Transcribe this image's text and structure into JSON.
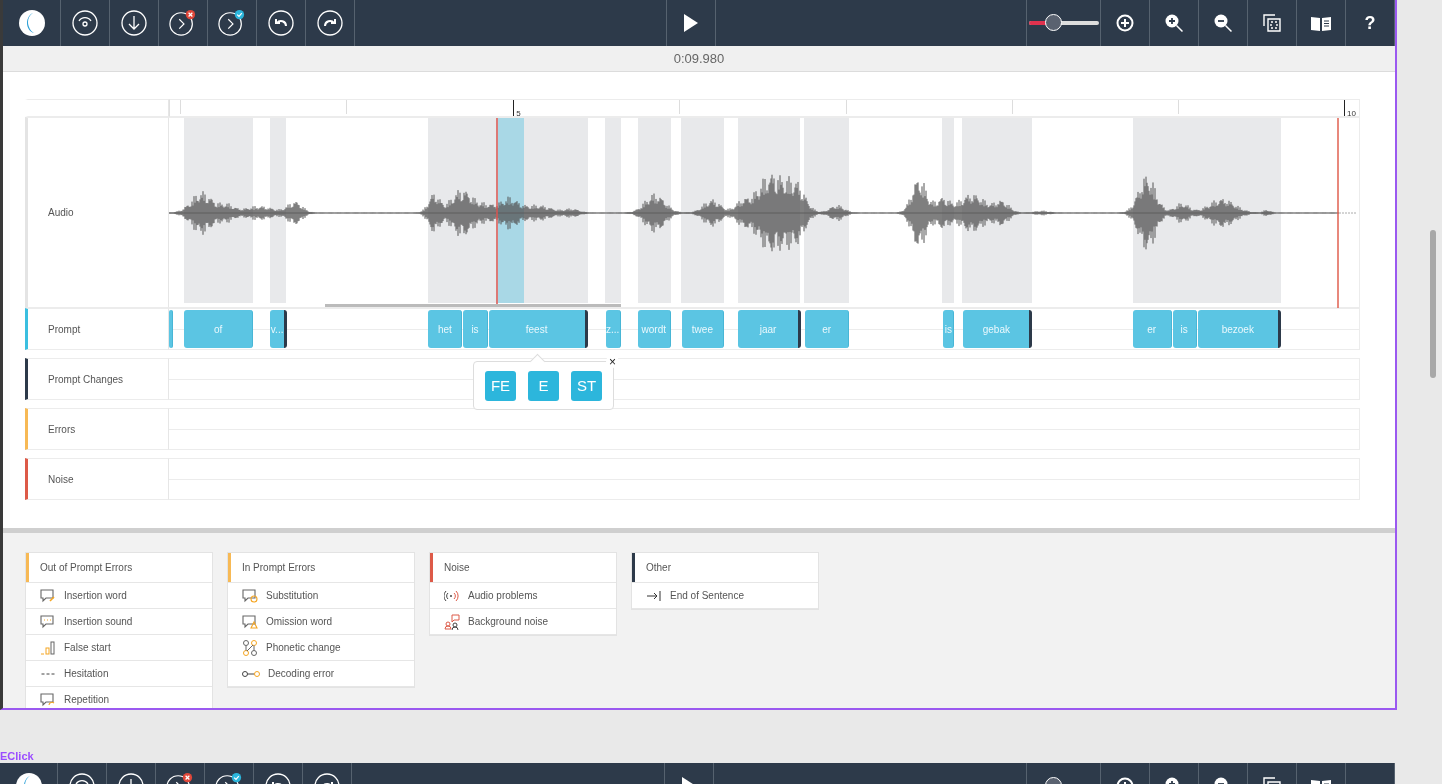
{
  "toolbar": {
    "zoom_slider": {
      "level": 0.35
    },
    "help": "?"
  },
  "time": "0:09.980",
  "timeline": {
    "ruler_labels": [
      "5",
      "10"
    ],
    "tracks": [
      {
        "name": "Audio",
        "kind": "audio",
        "color": "#e4e4e4"
      },
      {
        "name": "Prompt",
        "kind": "prompt",
        "color": "#3bbfe0"
      },
      {
        "name": "Prompt Changes",
        "kind": "lane",
        "color": "#2d3a4a"
      },
      {
        "name": "Errors",
        "kind": "lane",
        "color": "#f7b955"
      },
      {
        "name": "Noise",
        "kind": "lane",
        "color": "#dd5a48"
      }
    ],
    "prompt_words": [
      {
        "end_marker": false
      },
      {
        "text": "of",
        "end_marker": false
      },
      {
        "text": "v...",
        "end_marker": true
      },
      {
        "text": "het",
        "end_marker": false
      },
      {
        "text": "is",
        "end_marker": false
      },
      {
        "text": "feest",
        "end_marker": true
      },
      {
        "text": "z...",
        "end_marker": false
      },
      {
        "text": "wordt",
        "end_marker": false
      },
      {
        "text": "twee",
        "end_marker": false
      },
      {
        "text": "jaar",
        "end_marker": true
      },
      {
        "text": "er",
        "end_marker": false
      },
      {
        "text": "is",
        "end_marker": false
      },
      {
        "text": "gebak",
        "end_marker": true
      },
      {
        "text": "er",
        "end_marker": false
      },
      {
        "text": "is",
        "end_marker": false
      },
      {
        "text": "bezoek",
        "end_marker": true
      }
    ],
    "popup": {
      "syllables": [
        "FE",
        "E",
        "ST"
      ],
      "close": "×"
    }
  },
  "legend": [
    {
      "title": "Out of Prompt Errors",
      "color": "#f7b955",
      "items": [
        "Insertion word",
        "Insertion sound",
        "False start",
        "Hesitation",
        "Repetition"
      ]
    },
    {
      "title": "In Prompt Errors",
      "color": "#f7b955",
      "items": [
        "Substitution",
        "Omission word",
        "Phonetic change",
        "Decoding error"
      ]
    },
    {
      "title": "Noise",
      "color": "#dd5a48",
      "items": [
        "Audio problems",
        "Background noise"
      ]
    },
    {
      "title": "Other",
      "color": "#2d3a4a",
      "items": [
        "End of Sentence"
      ]
    }
  ],
  "footer_label": "EClick"
}
